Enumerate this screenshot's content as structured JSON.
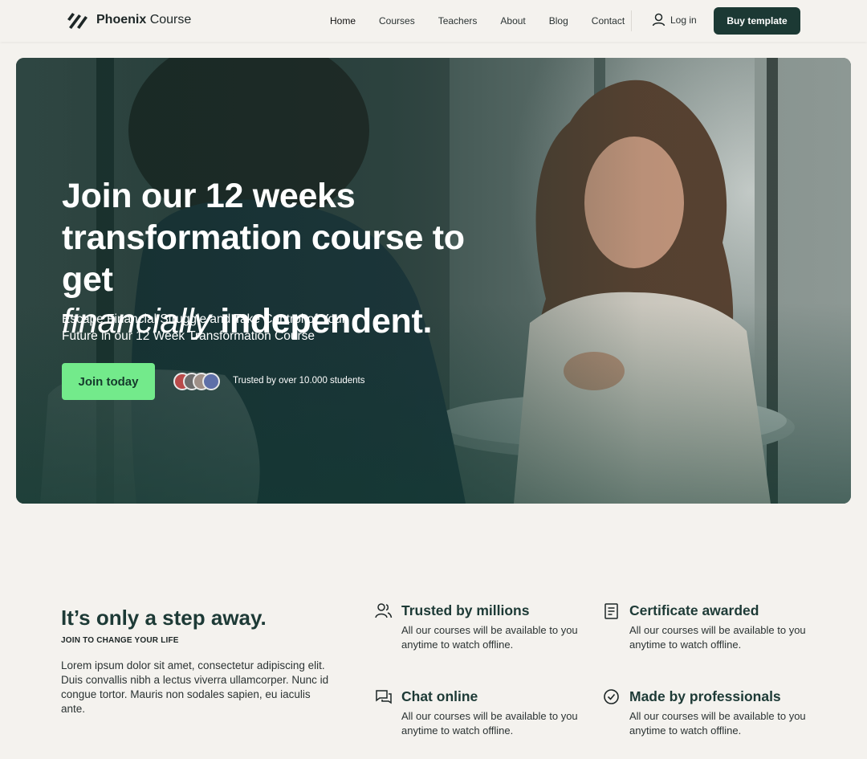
{
  "brand": {
    "name_bold": "Phoenix",
    "name_regular": "Course"
  },
  "nav": {
    "links": [
      "Home",
      "Courses",
      "Teachers",
      "About",
      "Blog",
      "Contact"
    ],
    "login_label": "Log in",
    "cta_label": "Buy template"
  },
  "hero": {
    "title_line1": "Join our 12 weeks",
    "title_line2": "transformation course to get",
    "title_italic": "financially",
    "title_end": "independent.",
    "subtitle": "Escape Financial Struggle and Take Control of Your Future in our 12 Week Transformation Course",
    "cta_label": "Join today",
    "trusted_text": "Trusted by over 10.000 students"
  },
  "step": {
    "title": "It’s only a step away.",
    "kicker": "JOIN TO CHANGE YOUR LIFE",
    "body": "Lorem ipsum dolor sit amet, consectetur adipiscing elit. Duis convallis nibh a lectus viverra ullamcorper. Nunc id congue tortor. Mauris non sodales sapien, eu iaculis ante."
  },
  "features": [
    {
      "icon": "users-icon",
      "title": "Trusted by millions",
      "desc": "All our courses will be available to you anytime to watch offline."
    },
    {
      "icon": "certificate-icon",
      "title": "Certificate awarded",
      "desc": "All our courses will be available to you anytime to watch offline."
    },
    {
      "icon": "chat-icon",
      "title": "Chat online",
      "desc": "All our courses will be available to you anytime to watch offline."
    },
    {
      "icon": "check-circle-icon",
      "title": "Made by professionals",
      "desc": "All our courses will be available to you anytime to watch offline."
    }
  ],
  "colors": {
    "background": "#f4f2ee",
    "primary_dark": "#1c3934",
    "accent_green": "#73ea8b",
    "heading": "#1d3a36"
  }
}
